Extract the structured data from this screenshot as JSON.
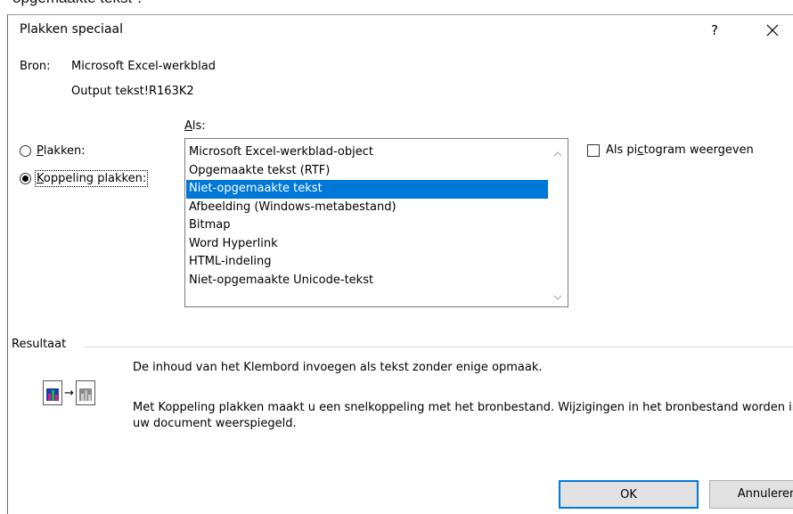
{
  "above_text": "opgemaakte tekst\".",
  "dialog": {
    "title": "Plakken speciaal",
    "help_label": "?",
    "close_label": "✕"
  },
  "source": {
    "label": "Bron:",
    "name": "Microsoft Excel-werkblad",
    "reference": "Output tekst!R163K2"
  },
  "paste_options": {
    "as_label_accel": "A",
    "as_label_rest": "ls:",
    "plakken_accel": "P",
    "plakken_rest": "lakken:",
    "koppeling_accel": "K",
    "koppeling_rest": "oppeling plakken:",
    "selected": "koppeling"
  },
  "list": {
    "items": [
      "Microsoft Excel-werkblad-object",
      "Opgemaakte tekst (RTF)",
      "Niet-opgemaakte tekst",
      "Afbeelding (Windows-metabestand)",
      "Bitmap",
      "Word Hyperlink",
      "HTML-indeling",
      "Niet-opgemaakte Unicode-tekst"
    ],
    "selected_index": 2
  },
  "icon_checkbox": {
    "label_pre": "Als pi",
    "label_accel": "c",
    "label_post": "togram weergeven",
    "checked": false
  },
  "result": {
    "label": "Resultaat",
    "line1": "De inhoud van het Klembord invoegen als tekst zonder enige opmaak.",
    "line2": "Met Koppeling plakken maakt u een snelkoppeling met het bronbestand. Wijzigingen in het bronbestand worden in uw document weerspiegeld.",
    "arrow": "→"
  },
  "buttons": {
    "ok": "OK",
    "cancel": "Annuleren"
  },
  "colors": {
    "accent": "#0078d7",
    "button_bg": "#e1e1e1"
  }
}
